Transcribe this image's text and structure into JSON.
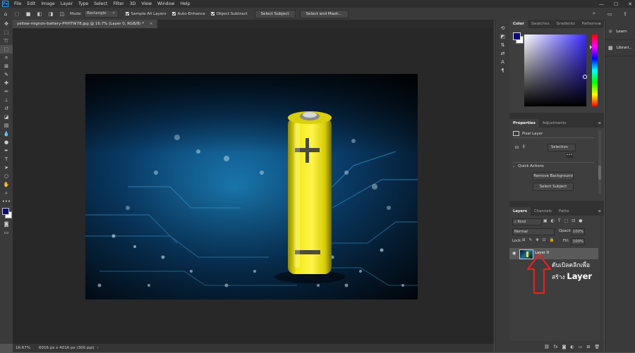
{
  "app": {
    "logo": "Ps"
  },
  "menu": [
    "File",
    "Edit",
    "Image",
    "Layer",
    "Type",
    "Select",
    "Filter",
    "3D",
    "View",
    "Window",
    "Help"
  ],
  "window_controls": {
    "minimize": "—",
    "maximize": "☐",
    "close": "✕"
  },
  "options_bar": {
    "mode_label": "Mode:",
    "mode_value": "Rectangle",
    "sample_all_layers": "Sample All Layers",
    "auto_enhance": "Auto-Enhance",
    "object_subtract": "Object Subtract",
    "select_subject": "Select Subject",
    "select_and_mask": "Select and Mask..."
  },
  "document": {
    "tab_title": "yellow-mignon-battery-PHHTW78.jpg @ 16.7% (Layer 0, RGB/8) *",
    "close": "×"
  },
  "status": {
    "zoom": "16.67%",
    "info": "6016 px x 4016 px (300 ppi)"
  },
  "color_panel": {
    "tabs": [
      "Color",
      "Swatches",
      "Gradients",
      "Patterns"
    ],
    "foreground": "#0a0a7a",
    "background": "#ffffff"
  },
  "properties_panel": {
    "tabs": [
      "Properties",
      "Adjustments"
    ],
    "layer_type": "Pixel Layer",
    "selection_dropdown": "Selection",
    "quick_actions_label": "Quick Actions",
    "remove_background": "Remove Background",
    "select_subject": "Select Subject",
    "more": "•••"
  },
  "layers_panel": {
    "tabs": [
      "Layers",
      "Channels",
      "Paths"
    ],
    "kind": "Kind",
    "blend_mode": "Normal",
    "opacity_label": "Opacity:",
    "opacity_value": "100%",
    "lock_label": "Lock:",
    "fill_label": "Fill:",
    "fill_value": "100%",
    "layers": [
      {
        "name": "Layer 0",
        "visible": true
      }
    ],
    "footer_icons": [
      "link-icon",
      "fx-icon",
      "mask-icon",
      "adjustment-icon",
      "folder-icon",
      "new-layer-icon",
      "trash-icon"
    ]
  },
  "learn_column": {
    "items": [
      "Learn",
      "Librari..."
    ]
  },
  "annotation": {
    "line1": "ดับเบิลคลิกเพื่อ",
    "line2": "สร้าง",
    "line3": "Layer",
    "arrow_color": "#e52222"
  }
}
